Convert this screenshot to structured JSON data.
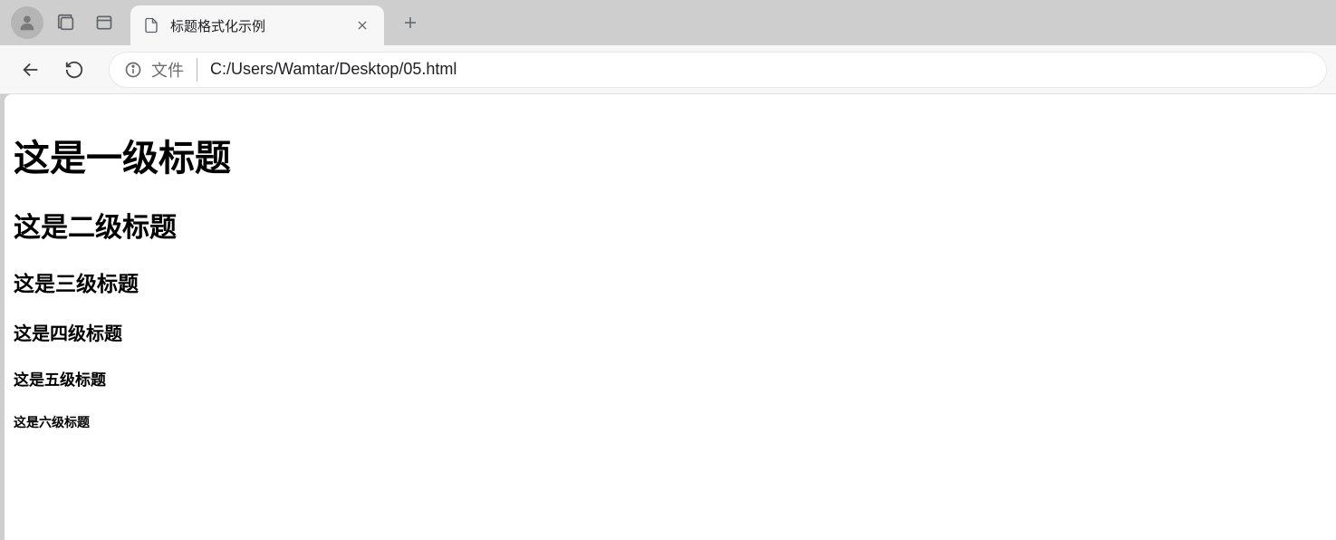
{
  "browser": {
    "tab_title": "标题格式化示例",
    "url_prefix": "文件",
    "url": "C:/Users/Wamtar/Desktop/05.html"
  },
  "content": {
    "h1": "这是一级标题",
    "h2": "这是二级标题",
    "h3": "这是三级标题",
    "h4": "这是四级标题",
    "h5": "这是五级标题",
    "h6": "这是六级标题"
  }
}
